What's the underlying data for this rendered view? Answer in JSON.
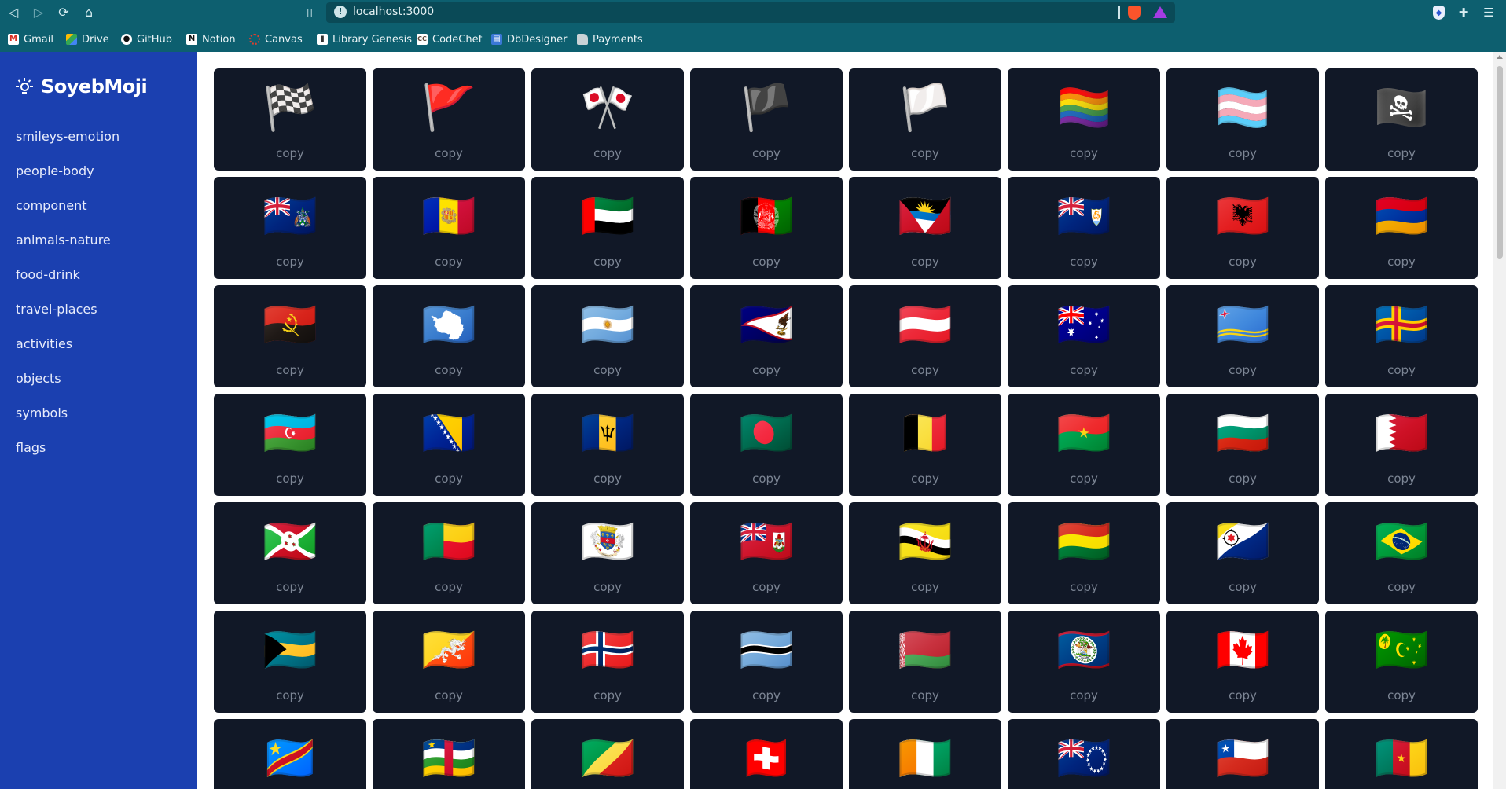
{
  "browser": {
    "url": "localhost:3000",
    "bookmarks": [
      {
        "label": "Gmail",
        "icon": "gmail-icon"
      },
      {
        "label": "Drive",
        "icon": "drive-icon"
      },
      {
        "label": "GitHub",
        "icon": "github-icon"
      },
      {
        "label": "Notion",
        "icon": "notion-icon"
      },
      {
        "label": "Canvas",
        "icon": "canvas-icon"
      },
      {
        "label": "Library Genesis",
        "icon": "book-icon"
      },
      {
        "label": "CodeChef",
        "icon": "codechef-icon"
      },
      {
        "label": "DbDesigner",
        "icon": "dbdesigner-icon"
      },
      {
        "label": "Payments",
        "icon": "folder-icon"
      }
    ]
  },
  "sidebar": {
    "brand": "SoyebMoji",
    "items": [
      {
        "label": "smileys-emotion"
      },
      {
        "label": "people-body"
      },
      {
        "label": "component"
      },
      {
        "label": "animals-nature"
      },
      {
        "label": "food-drink"
      },
      {
        "label": "travel-places"
      },
      {
        "label": "activities"
      },
      {
        "label": "objects"
      },
      {
        "label": "symbols"
      },
      {
        "label": "flags"
      }
    ]
  },
  "main": {
    "copy_label": "copy",
    "emojis": [
      "🏁",
      "🚩",
      "🎌",
      "🏴",
      "🏳️",
      "🏳️‍🌈",
      "🏳️‍⚧️",
      "🏴‍☠️",
      "🇦🇨",
      "🇦🇩",
      "🇦🇪",
      "🇦🇫",
      "🇦🇬",
      "🇦🇮",
      "🇦🇱",
      "🇦🇲",
      "🇦🇴",
      "🇦🇶",
      "🇦🇷",
      "🇦🇸",
      "🇦🇹",
      "🇦🇺",
      "🇦🇼",
      "🇦🇽",
      "🇦🇿",
      "🇧🇦",
      "🇧🇧",
      "🇧🇩",
      "🇧🇪",
      "🇧🇫",
      "🇧🇬",
      "🇧🇭",
      "🇧🇮",
      "🇧🇯",
      "🇧🇱",
      "🇧🇲",
      "🇧🇳",
      "🇧🇴",
      "🇧🇶",
      "🇧🇷",
      "🇧🇸",
      "🇧🇹",
      "🇧🇻",
      "🇧🇼",
      "🇧🇾",
      "🇧🇿",
      "🇨🇦",
      "🇨🇨",
      "🇨🇩",
      "🇨🇫",
      "🇨🇬",
      "🇨🇭",
      "🇨🇮",
      "🇨🇰",
      "🇨🇱",
      "🇨🇲"
    ]
  }
}
